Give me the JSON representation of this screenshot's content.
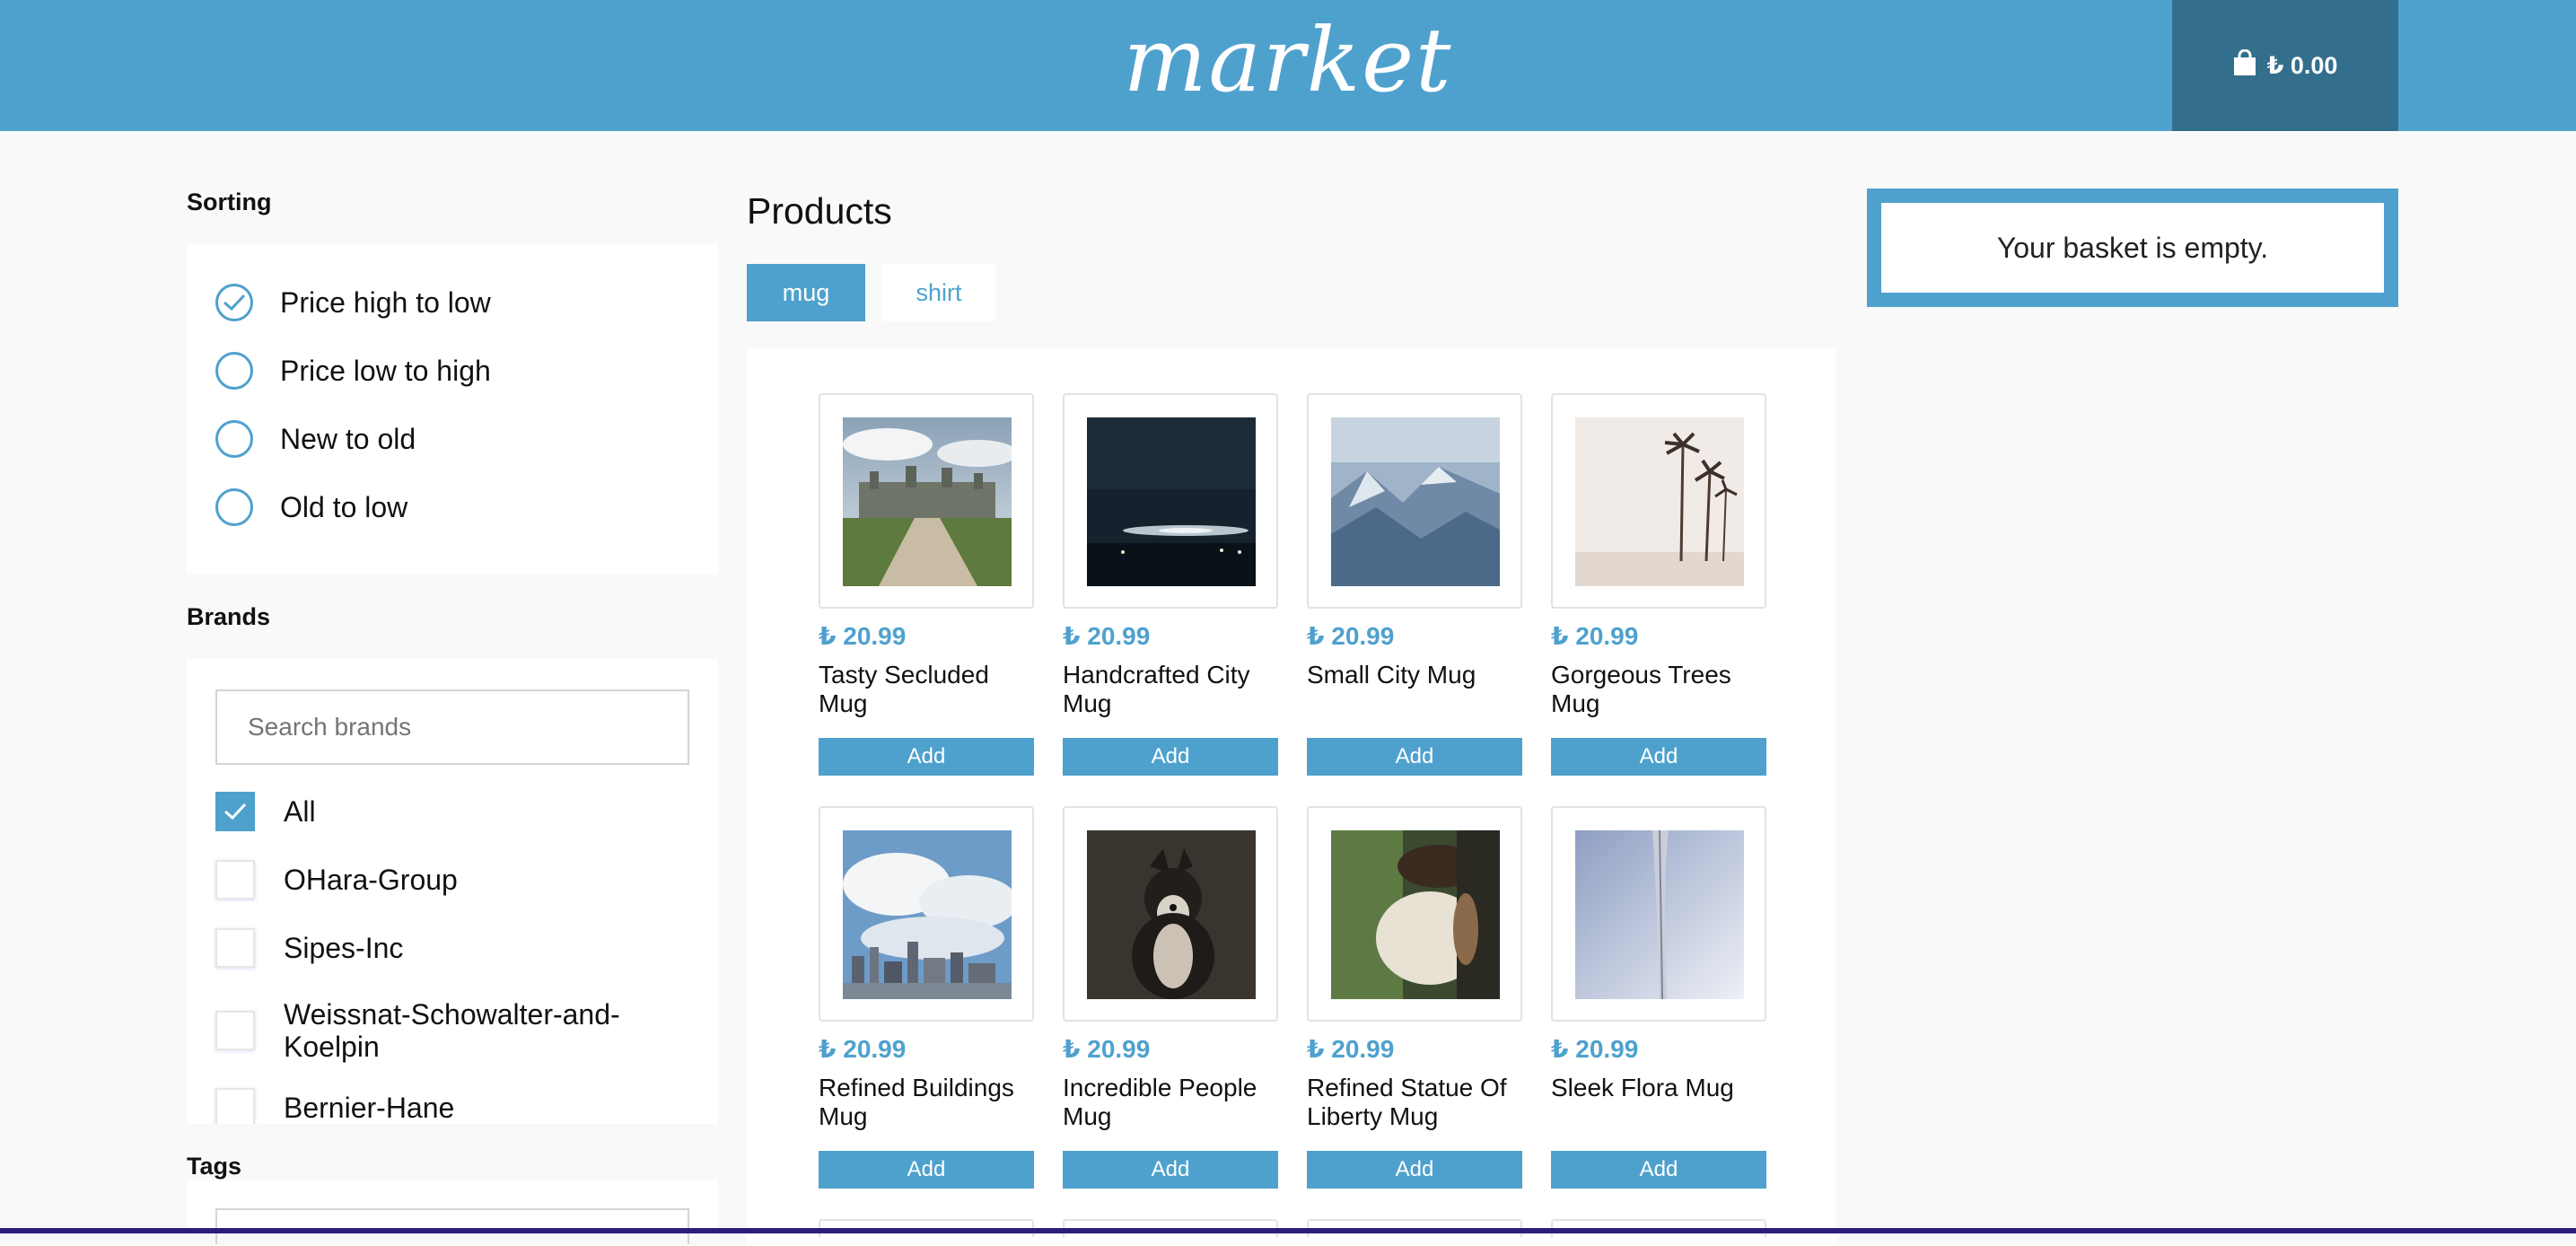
{
  "header": {
    "logo": "market",
    "basket_total": "₺ 0.00"
  },
  "sorting": {
    "title": "Sorting",
    "options": [
      {
        "label": "Price high to low",
        "selected": true
      },
      {
        "label": "Price low to high",
        "selected": false
      },
      {
        "label": "New to old",
        "selected": false
      },
      {
        "label": "Old to low",
        "selected": false
      }
    ]
  },
  "brands": {
    "title": "Brands",
    "search_placeholder": "Search brands",
    "items": [
      {
        "label": "All",
        "checked": true
      },
      {
        "label": "OHara-Group",
        "checked": false
      },
      {
        "label": "Sipes-Inc",
        "checked": false
      },
      {
        "label": "Weissnat-Schowalter-and-Koelpin",
        "checked": false
      },
      {
        "label": "Bernier-Hane",
        "checked": false
      }
    ]
  },
  "tags": {
    "title": "Tags"
  },
  "products": {
    "title": "Products",
    "tabs": [
      {
        "label": "mug",
        "active": true
      },
      {
        "label": "shirt",
        "active": false
      }
    ],
    "items": [
      {
        "price": "₺ 20.99",
        "name": "Tasty Secluded Mug",
        "add": "Add",
        "image": "castle-photo"
      },
      {
        "price": "₺ 20.99",
        "name": "Handcrafted City Mug",
        "add": "Add",
        "image": "night-city-photo"
      },
      {
        "price": "₺ 20.99",
        "name": "Small City Mug",
        "add": "Add",
        "image": "mountains-photo"
      },
      {
        "price": "₺ 20.99",
        "name": "Gorgeous Trees Mug",
        "add": "Add",
        "image": "palm-trees-photo"
      },
      {
        "price": "₺ 20.99",
        "name": "Refined Buildings Mug",
        "add": "Add",
        "image": "skyline-photo"
      },
      {
        "price": "₺ 20.99",
        "name": "Incredible People Mug",
        "add": "Add",
        "image": "dog-photo"
      },
      {
        "price": "₺ 20.99",
        "name": "Refined Statue Of Liberty Mug",
        "add": "Add",
        "image": "driver-photo"
      },
      {
        "price": "₺ 20.99",
        "name": "Sleek Flora Mug",
        "add": "Add",
        "image": "arch-photo"
      }
    ]
  },
  "basket": {
    "empty_message": "Your basket is empty."
  },
  "colors": {
    "accent": "#4fa1cd",
    "header_dark": "#336f8c",
    "background": "#f9f9f9"
  }
}
